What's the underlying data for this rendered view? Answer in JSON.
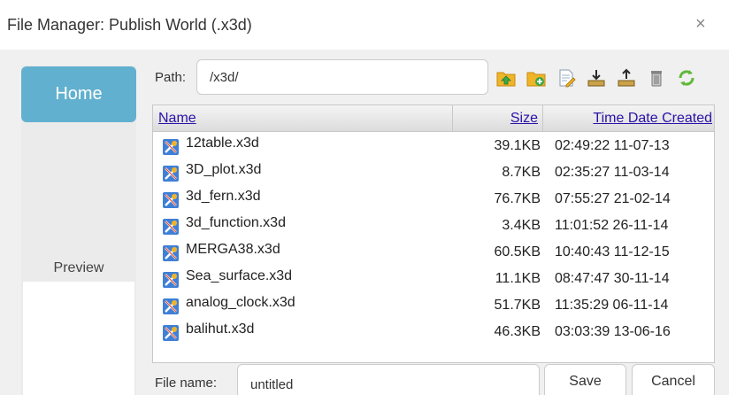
{
  "dialog": {
    "title": "File Manager: Publish World (.x3d)",
    "close_glyph": "×",
    "close_icon": "close-icon"
  },
  "sidebar": {
    "home_label": "Home",
    "preview_label": "Preview"
  },
  "path": {
    "label": "Path:",
    "value": "/x3d/"
  },
  "toolbar": {
    "icons": [
      "folder-up-icon",
      "new-folder-icon",
      "edit-file-icon",
      "download-icon",
      "upload-icon",
      "delete-icon",
      "refresh-icon"
    ]
  },
  "listing": {
    "columns": {
      "name": "Name",
      "size": "Size",
      "date": "Time Date Created"
    },
    "rows": [
      {
        "name": "12table.x3d",
        "size": "39.1KB",
        "date": "02:49:22 11-07-13"
      },
      {
        "name": "3D_plot.x3d",
        "size": "8.7KB",
        "date": "02:35:27 11-03-14"
      },
      {
        "name": "3d_fern.x3d",
        "size": "76.7KB",
        "date": "07:55:27 21-02-14"
      },
      {
        "name": "3d_function.x3d",
        "size": "3.4KB",
        "date": "11:01:52 26-11-14"
      },
      {
        "name": "MERGA38.x3d",
        "size": "60.5KB",
        "date": "10:40:43 11-12-15"
      },
      {
        "name": "Sea_surface.x3d",
        "size": "11.1KB",
        "date": "08:47:47 30-11-14"
      },
      {
        "name": "analog_clock.x3d",
        "size": "51.7KB",
        "date": "11:35:29 06-11-14"
      },
      {
        "name": "balihut.x3d",
        "size": "46.3KB",
        "date": "03:03:39 13-06-16"
      }
    ]
  },
  "footer": {
    "filename_label": "File name:",
    "filename_value": "untitled",
    "save_label": "Save",
    "cancel_label": "Cancel"
  },
  "colors": {
    "accent": "#62b0cf",
    "header_link": "#2a12a8"
  }
}
